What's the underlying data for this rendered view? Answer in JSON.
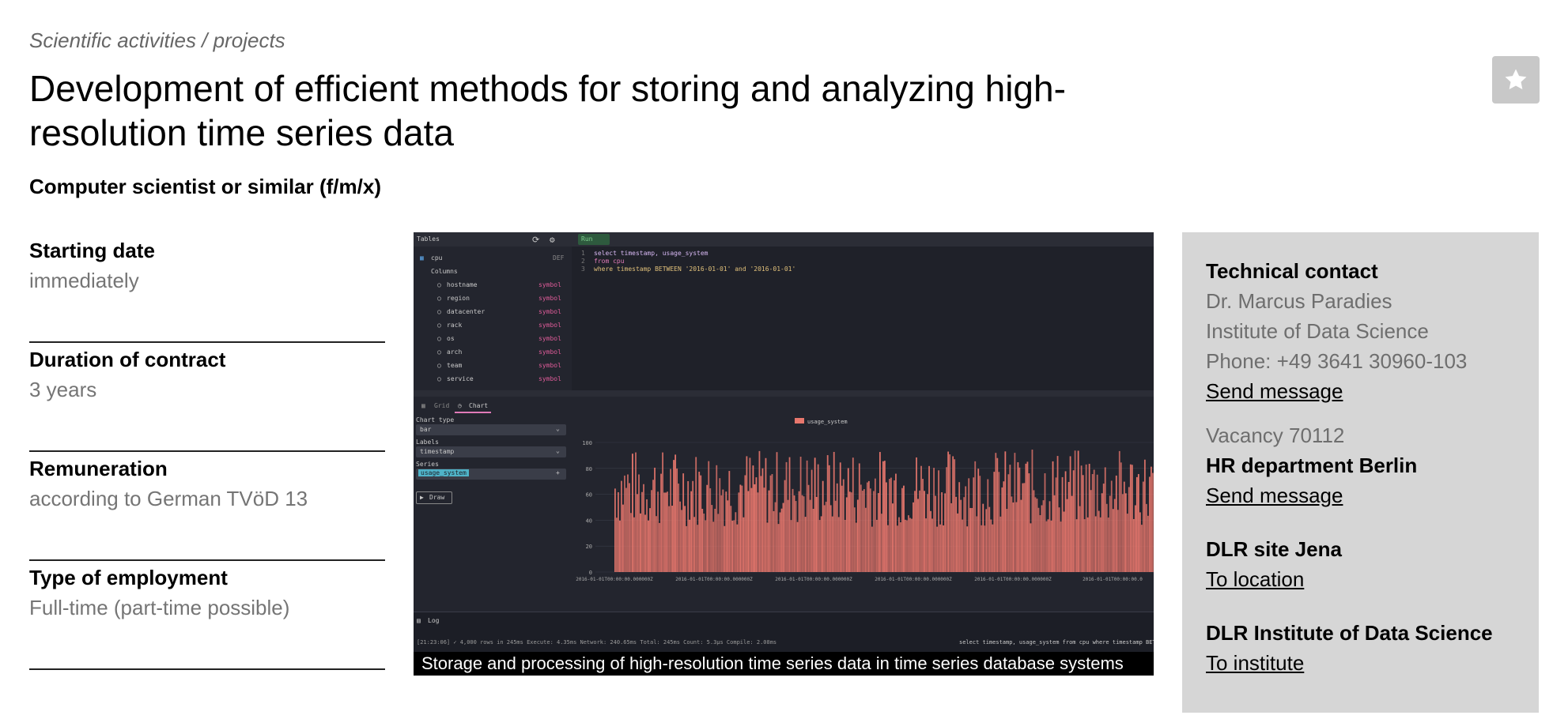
{
  "breadcrumb": "Scientific activities / projects",
  "title": "Development of efficient methods for storing and analyzing high-resolution time series data",
  "favorite_icon": "star-icon",
  "job_title": "Computer scientist or similar (f/m/x)",
  "facts": [
    {
      "label": "Starting date",
      "value": "immediately"
    },
    {
      "label": "Duration of contract",
      "value": "3 years"
    },
    {
      "label": "Remuneration",
      "value": "according to German TVöD 13"
    },
    {
      "label": "Type of employment",
      "value": "Full-time (part-time possible)"
    }
  ],
  "figure": {
    "caption": "Storage and processing of high-resolution time series data in time series database systems",
    "tables_label": "Tables",
    "table_name": "cpu",
    "table_kind": "DEF",
    "columns_label": "Columns",
    "columns": [
      "hostname",
      "region",
      "datacenter",
      "rack",
      "os",
      "arch",
      "team",
      "service"
    ],
    "column_type": "symbol",
    "run_label": "Run",
    "query_lines": [
      "select timestamp, usage_system",
      "  from cpu",
      "  where timestamp BETWEEN '2016-01-01' and '2016-01-01'"
    ],
    "tab_grid": "Grid",
    "tab_chart": "Chart",
    "chart_type_label": "Chart type",
    "chart_type_value": "bar",
    "labels_label": "Labels",
    "labels_value": "timestamp",
    "series_label": "Series",
    "series_value": "usage_system",
    "draw_label": "Draw",
    "legend": "usage_system",
    "y_ticks": [
      "100",
      "80",
      "60",
      "40",
      "20",
      "0"
    ],
    "x_ticks": [
      "2016-01-01T00:00:00.000000Z",
      "2016-01-01T00:00:00.000000Z",
      "2016-01-01T00:00:00.000000Z",
      "2016-01-01T00:00:00.000000Z",
      "2016-01-01T00:00:00.000000Z",
      "2016-01-01T00:00:00.0"
    ],
    "log_label": "Log",
    "log_status": "[21:23:06] ✓ 4,000 rows in 245ms  Execute: 4.35ms  Network: 240.65ms  Total: 245ms   Count: 5.3µs  Compile: 2.08ms",
    "log_query": "select timestamp, usage_system from cpu where timestamp BETW",
    "bar_color": "#e8776d"
  },
  "contact": {
    "technical_label": "Technical contact",
    "name": "Dr. Marcus Paradies",
    "institute": "Institute of Data Science",
    "phone": "Phone: +49 3641 30960-103",
    "send_message": "Send message",
    "vacancy": "Vacancy 70112",
    "hr_label": "HR department Berlin",
    "hr_send_message": "Send message",
    "site_label": "DLR site Jena",
    "site_link": "To location",
    "institute_label": "DLR Institute of Data Science",
    "institute_link": "To institute"
  }
}
